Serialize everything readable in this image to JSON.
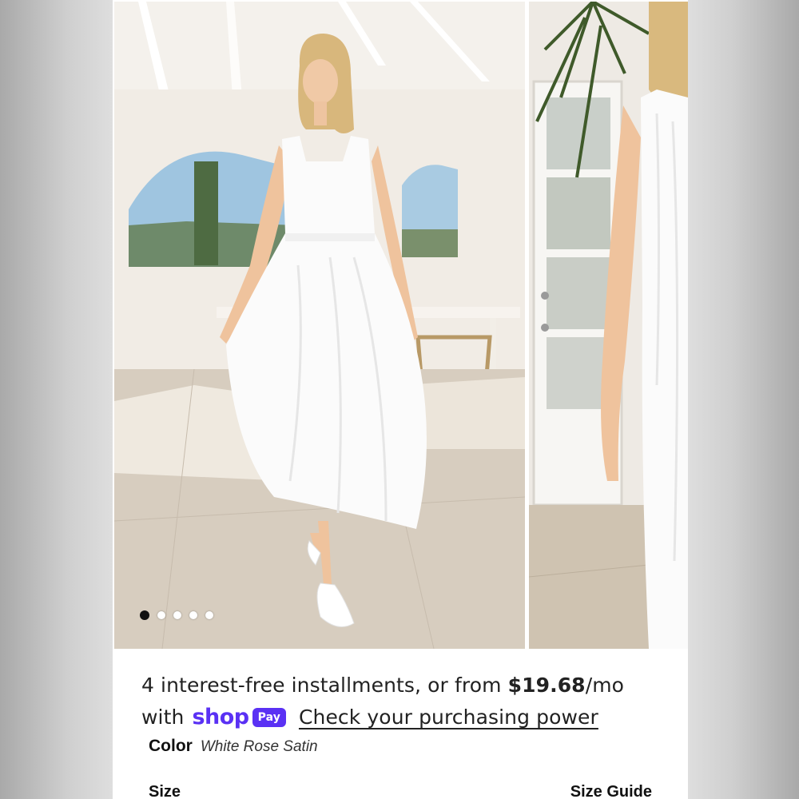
{
  "gallery": {
    "image_count": 5,
    "active_index": 0,
    "main_image": "model-in-white-rose-satin-dress",
    "side_image": "dress-side-view"
  },
  "payment": {
    "line1_text": "4 interest-free installments, or from ",
    "price": "$19.68",
    "per_month": "/mo",
    "with_text": "with",
    "shop_logo": "shop",
    "pay_badge": "Pay",
    "link_text": "Check your purchasing power",
    "brand_color": "#5a31f4"
  },
  "product": {
    "color_label": "Color",
    "color_value": "White Rose Satin",
    "size_label": "Size",
    "size_guide_label": "Size Guide"
  }
}
